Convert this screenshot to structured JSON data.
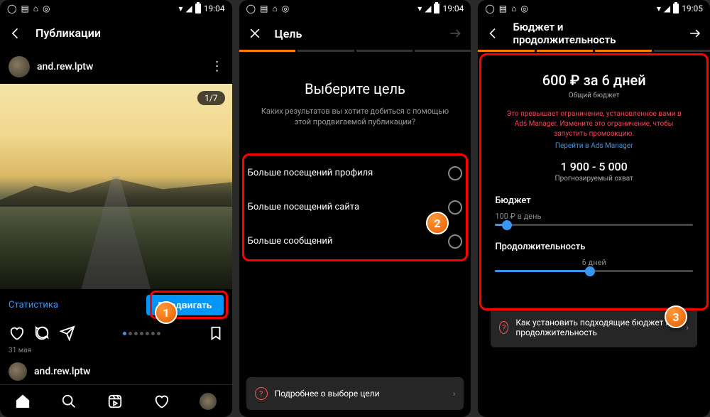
{
  "status": {
    "time1": "19:04",
    "time2": "19:04",
    "time3": "19:05"
  },
  "screen1": {
    "header_title": "Публикации",
    "username": "and.rew.lptw",
    "photo_counter": "1/7",
    "stats_link": "Статистика",
    "promote_btn": "Продвигать",
    "post_date": "31 мая",
    "username2": "and.rew.lptw"
  },
  "screen2": {
    "header_title": "Цель",
    "title": "Выберите цель",
    "subtitle": "Каких результатов вы хотите добиться с помощью этой продвигаемой публикации?",
    "options": [
      "Больше посещений профиля",
      "Больше посещений сайта",
      "Больше сообщений"
    ],
    "help": "Подробнее о выборе цели"
  },
  "screen3": {
    "header_title": "Бюджет и продолжительность",
    "budget_headline": "600 ₽ за 6 дней",
    "budget_sub": "Общий бюджет",
    "warning": "Это превышает ограничение, установленное вами в Ads Manager. Измените это ограничение, чтобы запустить промоакцию.",
    "ads_link": "Перейти в Ads Manager",
    "reach": "1 900 - 5 000",
    "reach_sub": "Прогнозируемый охват",
    "budget_label": "Бюджет",
    "budget_value": "100 ₽ в день",
    "duration_label": "Продолжительность",
    "duration_value": "6 дней",
    "help": "Как установить подходящие бюджет и продолжительность"
  },
  "steps": {
    "s1": "1",
    "s2": "2",
    "s3": "3"
  }
}
